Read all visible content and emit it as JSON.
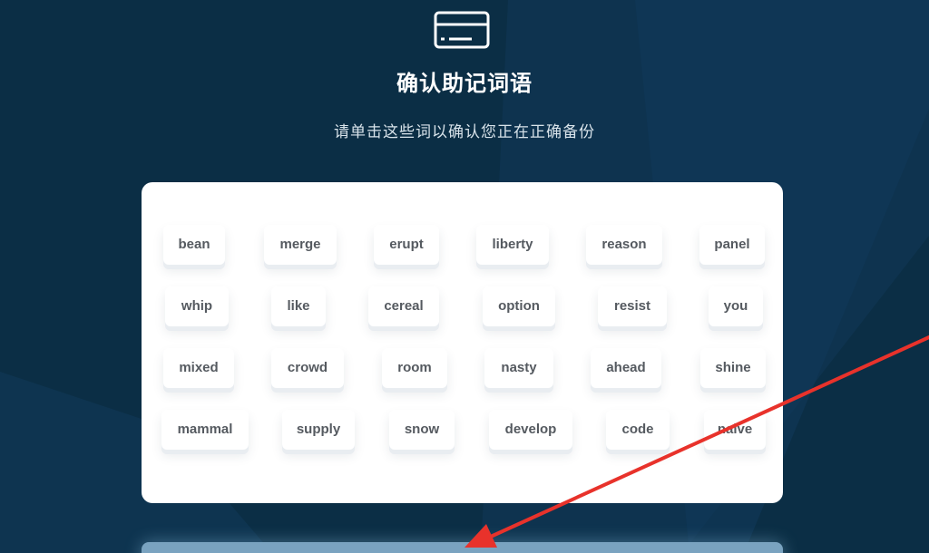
{
  "header": {
    "icon": "card-icon",
    "title": "确认助记词语",
    "subtitle": "请单击这些词以确认您正在正确备份"
  },
  "words": [
    "bean",
    "merge",
    "erupt",
    "liberty",
    "reason",
    "panel",
    "whip",
    "like",
    "cereal",
    "option",
    "resist",
    "you",
    "mixed",
    "crowd",
    "room",
    "nasty",
    "ahead",
    "shine",
    "mammal",
    "supply",
    "snow",
    "develop",
    "code",
    "naive"
  ],
  "colors": {
    "background": "#0b2e45",
    "card": "#ffffff",
    "word_text": "#555a60",
    "confirm_bar": "#7aa3c0",
    "annotation_arrow": "#e8322b"
  }
}
